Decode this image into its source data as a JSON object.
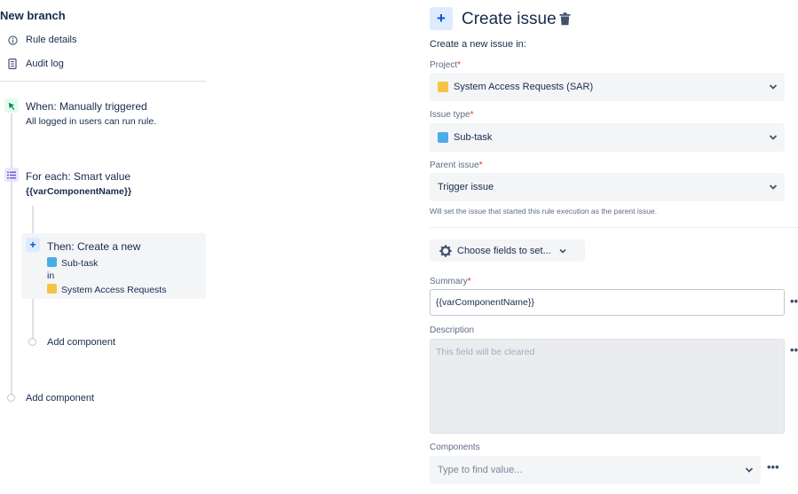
{
  "left": {
    "title": "New branch",
    "menu": [
      {
        "label": "Rule details",
        "icon": "info-icon"
      },
      {
        "label": "Audit log",
        "icon": "document-icon"
      }
    ],
    "trigger": {
      "title": "When: Manually triggered",
      "subtitle": "All logged in users can run rule.",
      "icon": "cursor-click-icon",
      "color": "#36b37e"
    },
    "foreach": {
      "title": "For each: Smart value",
      "value": "{{varComponentName}}",
      "icon": "list-icon",
      "color": "#6554c0"
    },
    "action": {
      "title": "Then: Create a new",
      "issue_type": "Sub-task",
      "connector": "in",
      "project": "System Access Requests",
      "icon": "plus-icon",
      "color": "#0052cc"
    },
    "add_component_inner": "Add component",
    "add_component_outer": "Add component"
  },
  "right": {
    "title": "Create issue",
    "intro": "Create a new issue in:",
    "project": {
      "label": "Project",
      "required": "*",
      "value": "System Access Requests (SAR)"
    },
    "issue_type": {
      "label": "Issue type",
      "required": "*",
      "value": "Sub-task"
    },
    "parent_issue": {
      "label": "Parent issue",
      "required": "*",
      "value": "Trigger issue",
      "helper": "Will set the issue that started this rule execution as the parent issue."
    },
    "choose_fields": "Choose fields to set...",
    "summary": {
      "label": "Summary",
      "required": "*",
      "value": "{{varComponentName}}"
    },
    "description": {
      "label": "Description",
      "placeholder": "This field will be cleared"
    },
    "components": {
      "label": "Components",
      "placeholder": "Type to find value..."
    },
    "more": "•••"
  },
  "colors": {
    "accent": "#0052cc",
    "required": "#de350b",
    "project_icon": "#f6c342",
    "subtask_icon": "#4bade8"
  }
}
